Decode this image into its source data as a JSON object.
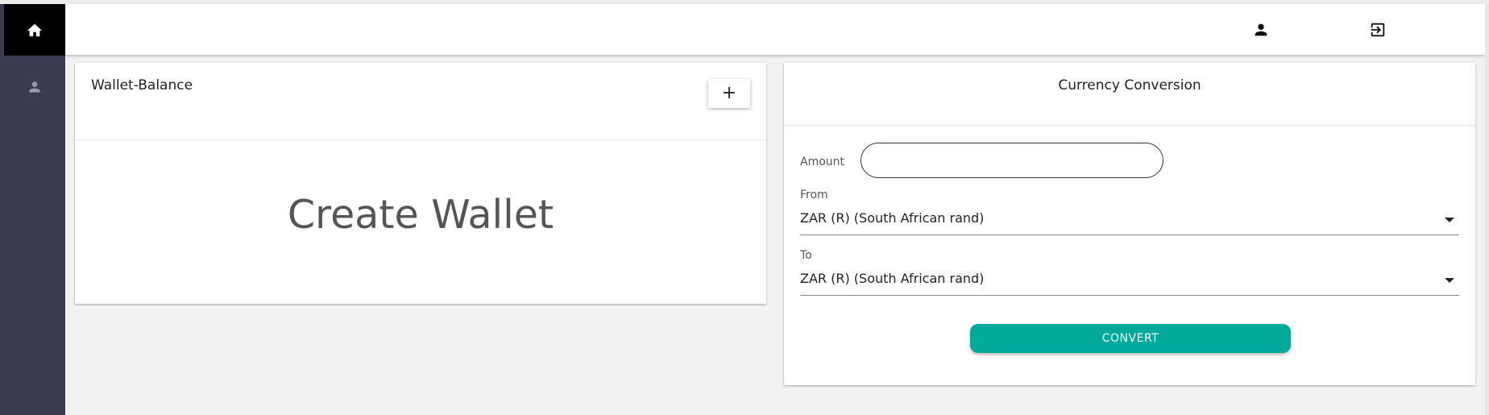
{
  "sidebar": {
    "items": [
      {
        "icon": "home-icon"
      },
      {
        "icon": "person-icon"
      }
    ]
  },
  "header": {
    "actions": [
      {
        "icon": "person-icon"
      },
      {
        "icon": "logout-icon"
      }
    ]
  },
  "wallet": {
    "title": "Wallet-Balance",
    "add_label": "+",
    "create_label": "Create Wallet"
  },
  "conversion": {
    "title": "Currency Conversion",
    "amount_label": "Amount",
    "amount_value": "",
    "from_label": "From",
    "from_value": "ZAR (R) (South African rand)",
    "to_label": "To",
    "to_value": "ZAR (R) (South African rand)",
    "convert_label": "CONVERT"
  },
  "colors": {
    "sidebar_bg": "#3b3a4e",
    "sidebar_active_bg": "#000000",
    "accent": "#00a99a",
    "page_bg": "#f2f2f2"
  }
}
